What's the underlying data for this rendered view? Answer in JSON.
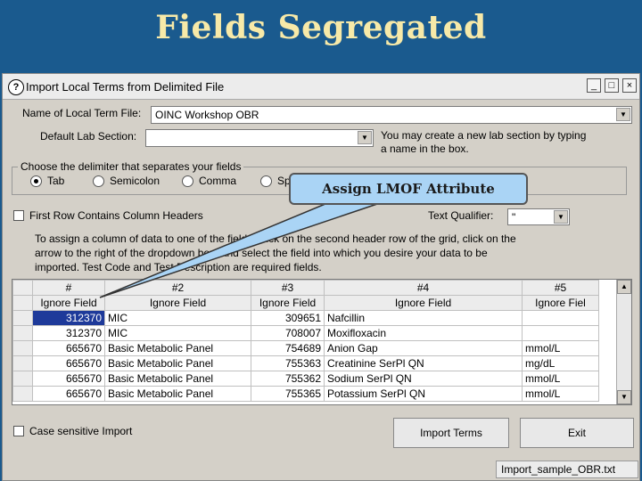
{
  "slide": {
    "title": "Fields Segregated"
  },
  "window": {
    "icon_glyph": "?",
    "title": "Import Local Terms from Delimited File",
    "buttons": {
      "minimize": "_",
      "maximize": "□",
      "close": "×"
    }
  },
  "form": {
    "local_term_label": "Name of Local Term File:",
    "local_term_value": "OINC Workshop OBR",
    "lab_section_label": "Default Lab Section:",
    "lab_section_value": "",
    "lab_section_hint": "You may create a new lab section by typing a name in the box.",
    "delimiter_group_label": "Choose the delimiter that separates your fields",
    "delimiters": [
      "Tab",
      "Semicolon",
      "Comma",
      "Sp"
    ],
    "selected_delimiter": "Tab",
    "first_row_headers_label": "First Row Contains Column Headers",
    "first_row_headers_checked": false,
    "text_qualifier_label": "Text Qualifier:",
    "text_qualifier_value": "\"",
    "instructions": "To assign a column of data to one of the fields, click on the second header row of the grid, click on the arrow to the right of the dropdown box, and select the field into which you desire your data to be imported. Test Code and Test Description are required fields."
  },
  "grid": {
    "columns": [
      "#",
      "#2",
      "#3",
      "#4",
      "#5"
    ],
    "field_assignments": [
      "Ignore Field",
      "Ignore Field",
      "Ignore Field",
      "Ignore Field",
      "Ignore Fiel"
    ],
    "rows": [
      [
        "312370",
        "MIC",
        "309651",
        "Nafcillin",
        ""
      ],
      [
        "312370",
        "MIC",
        "708007",
        "Moxifloxacin",
        ""
      ],
      [
        "665670",
        "Basic Metabolic Panel",
        "754689",
        "Anion Gap",
        "mmol/L"
      ],
      [
        "665670",
        "Basic Metabolic Panel",
        "755363",
        "Creatinine SerPl QN",
        "mg/dL"
      ],
      [
        "665670",
        "Basic Metabolic Panel",
        "755362",
        "Sodium SerPl QN",
        "mmol/L"
      ],
      [
        "665670",
        "Basic Metabolic Panel",
        "755365",
        "Potassium SerPl QN",
        "mmol/L"
      ]
    ]
  },
  "footer": {
    "case_sensitive_label": "Case sensitive Import",
    "import_button": "Import Terms",
    "exit_button": "Exit",
    "status_filename": "Import_sample_OBR.txt"
  },
  "callout": {
    "text": "Assign LMOF Attribute"
  },
  "colors": {
    "slide_background": "#1a5a8e",
    "title_color": "#f7e9a8",
    "callout_fill": "#aad4f5",
    "selected_cell": "#1e3a9a"
  }
}
